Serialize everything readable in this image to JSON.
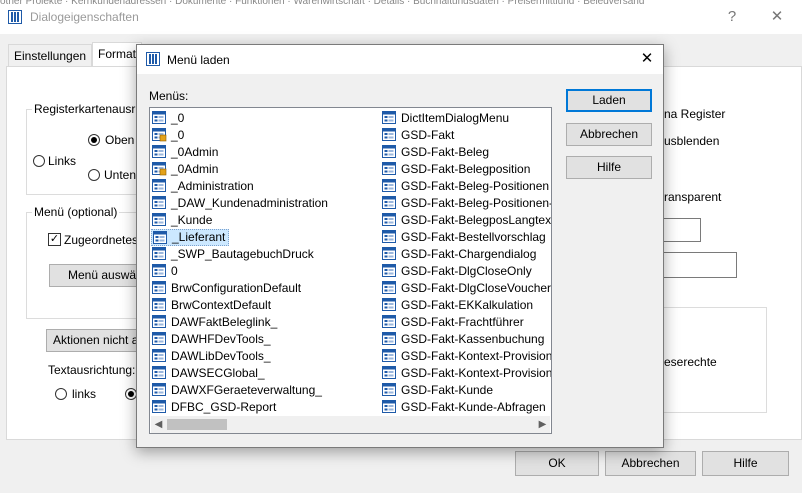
{
  "outer": {
    "top_text": "other Projekte · Kernkundenadressen · Dokumente · Funktionen · Warenwirtschaft · Details · Buchhaltungsdaten · Preisermittlung · Belegversand",
    "title": "Dialogeigenschaften",
    "help": "?",
    "close": "✕",
    "tabs": [
      "Einstellungen",
      "Format"
    ],
    "group_register": "Registerkartenausric",
    "radio_oben": "Oben",
    "radio_links": "Links",
    "radio_unten": "Unten",
    "right_text_1": "na Register",
    "right_text_2": "usblenden",
    "right_text_3": "ransparent",
    "right_text_4": "eserechte",
    "group_menu": "Menü (optional)",
    "check_zugeordnet": "Zugeordnetes",
    "btn_menu": "Menü auswä",
    "btn_aktionen": "Aktionen nicht a",
    "textausrichtung": "Textausrichtung:",
    "radio_links2": "links",
    "ok": "OK",
    "abbrechen": "Abbrechen",
    "hilfe": "Hilfe"
  },
  "modal": {
    "title": "Menü laden",
    "close": "✕",
    "menus_label": "Menüs:",
    "buttons": {
      "load": "Laden",
      "cancel": "Abbrechen",
      "help": "Hilfe"
    },
    "col1": [
      "_0",
      "_0",
      "_0Admin",
      "_0Admin",
      "_Administration",
      "_DAW_Kundenadministration",
      "_Kunde",
      "_Lieferant",
      "_SWP_BautagebuchDruck",
      "0",
      "BrwConfigurationDefault",
      "BrwContextDefault",
      "DAWFaktBeleglink_",
      "DAWHFDevTools_",
      "DAWLibDevTools_",
      "DAWSECGlobal_",
      "DAWXFGeraeteverwaltung_",
      "DFBC_GSD-Report"
    ],
    "col2": [
      "DictItemDialogMenu",
      "GSD-Fakt",
      "GSD-Fakt-Beleg",
      "GSD-Fakt-Belegposition",
      "GSD-Fakt-Beleg-Positionen",
      "GSD-Fakt-Beleg-Positionen-",
      "GSD-Fakt-BelegposLangtext",
      "GSD-Fakt-Bestellvorschlag",
      "GSD-Fakt-Chargendialog",
      "GSD-Fakt-DlgCloseOnly",
      "GSD-Fakt-DlgCloseVoucherIt",
      "GSD-Fakt-EKKalkulation",
      "GSD-Fakt-Frachtführer",
      "GSD-Fakt-Kassenbuchung",
      "GSD-Fakt-Kontext-Provision",
      "GSD-Fakt-Kontext-Provision",
      "GSD-Fakt-Kunde",
      "GSD-Fakt-Kunde-Abfragen"
    ],
    "selected_index_col1": 7,
    "icon_variants_col1": [
      "menu-icon",
      "menu-lock-icon",
      "menu-icon",
      "menu-lock-icon",
      "menu-icon",
      "menu-icon",
      "menu-icon",
      "menu-icon",
      "menu-icon",
      "menu-icon",
      "menu-icon",
      "menu-icon",
      "menu-icon",
      "menu-icon",
      "menu-icon",
      "menu-icon",
      "menu-icon",
      "menu-icon"
    ],
    "scroll_left": "◀",
    "scroll_right": "▶"
  },
  "colors": {
    "selection": "#cce8ff",
    "accent": "#0078d7",
    "icon_blue": "#1e5aa8"
  }
}
